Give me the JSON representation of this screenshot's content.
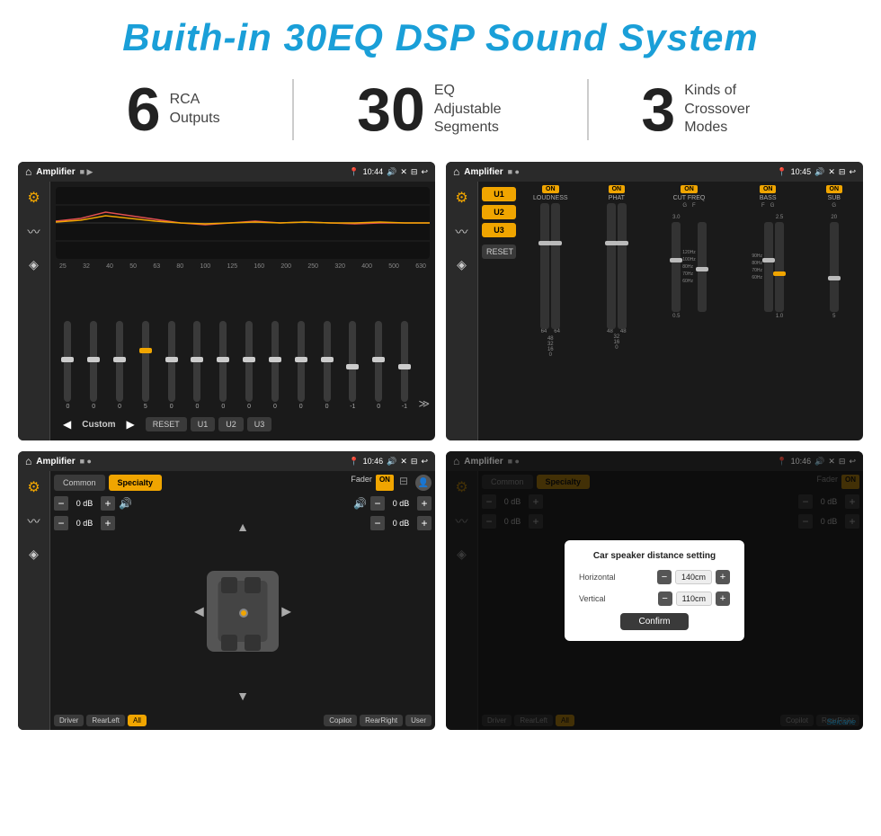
{
  "title": "Buith-in 30EQ DSP Sound System",
  "stats": [
    {
      "number": "6",
      "label": "RCA\nOutputs"
    },
    {
      "number": "30",
      "label": "EQ Adjustable\nSegments"
    },
    {
      "number": "3",
      "label": "Kinds of\nCrossover Modes"
    }
  ],
  "screens": [
    {
      "id": "eq-screen",
      "app": "Amplifier",
      "time": "10:44",
      "type": "equalizer",
      "frequencies": [
        "25",
        "32",
        "40",
        "50",
        "63",
        "80",
        "100",
        "125",
        "160",
        "200",
        "250",
        "320",
        "400",
        "500",
        "630"
      ],
      "values": [
        "0",
        "0",
        "0",
        "5",
        "0",
        "0",
        "0",
        "0",
        "0",
        "0",
        "0",
        "-1",
        "0",
        "-1"
      ],
      "labels": [
        "Custom"
      ],
      "controls": [
        "RESET",
        "U1",
        "U2",
        "U3"
      ]
    },
    {
      "id": "crossover-screen",
      "app": "Amplifier",
      "time": "10:45",
      "type": "crossover",
      "presets": [
        "U1",
        "U2",
        "U3"
      ],
      "channels": [
        "LOUDNESS",
        "PHAT",
        "CUT FREQ",
        "BASS",
        "SUB"
      ],
      "channelSubs": [
        "",
        "",
        "G    F",
        "F    G",
        "G"
      ]
    },
    {
      "id": "fader-screen",
      "app": "Amplifier",
      "time": "10:46",
      "type": "fader",
      "tabs": [
        "Common",
        "Specialty"
      ],
      "faderLabel": "Fader",
      "faderOnLabel": "ON",
      "zones": [
        "Driver",
        "RearLeft",
        "All",
        "User",
        "Copilot",
        "RearRight"
      ],
      "dbValues": [
        "0 dB",
        "0 dB",
        "0 dB",
        "0 dB"
      ]
    },
    {
      "id": "dialog-screen",
      "app": "Amplifier",
      "time": "10:46",
      "type": "dialog",
      "tabs": [
        "Common",
        "Specialty"
      ],
      "dialogTitle": "Car speaker distance setting",
      "horizontal": "140cm",
      "vertical": "110cm",
      "confirmLabel": "Confirm",
      "zones": [
        "Driver",
        "RearLeft",
        "All",
        "User",
        "Copilot",
        "RearRight"
      ],
      "dbValues": [
        "0 dB",
        "0 dB"
      ]
    }
  ],
  "watermark": "Seicane"
}
